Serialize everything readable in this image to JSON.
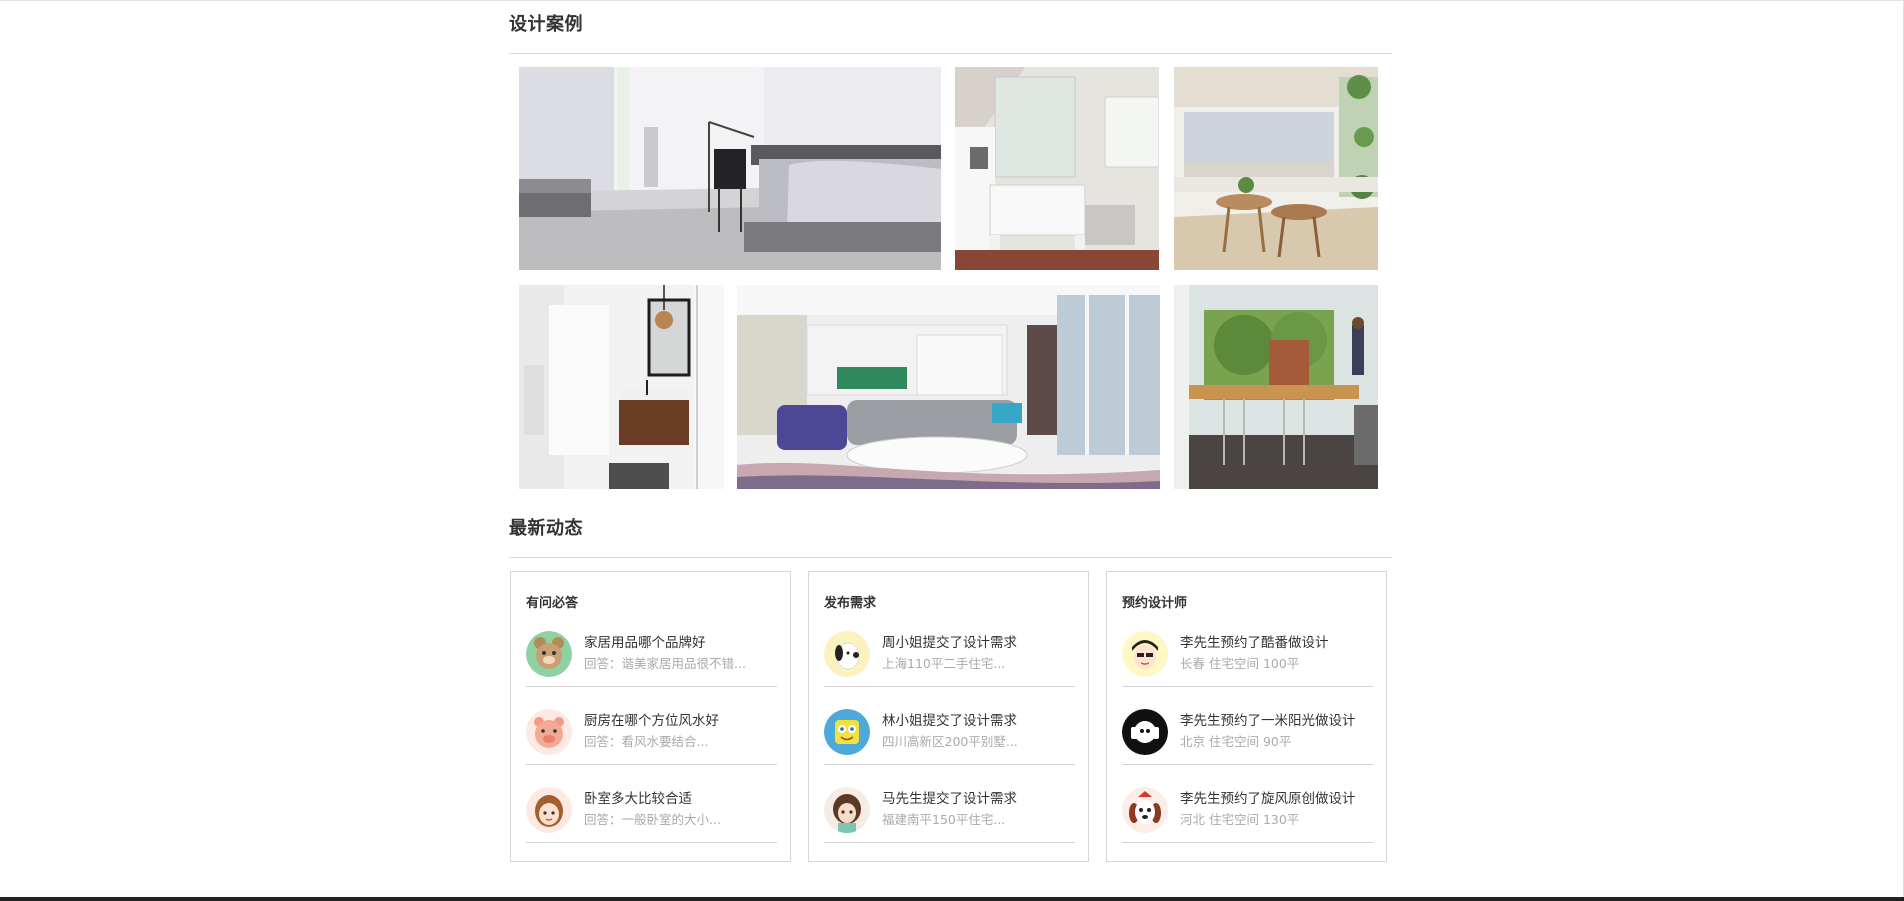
{
  "sections": {
    "cases_title": "设计案例",
    "news_title": "最新动态"
  },
  "cases": [
    {
      "name": "bedroom",
      "alt": "卧室"
    },
    {
      "name": "dressing-room",
      "alt": "梳妆间"
    },
    {
      "name": "sunroom",
      "alt": "阳光房"
    },
    {
      "name": "bathroom",
      "alt": "卫生间"
    },
    {
      "name": "living-room",
      "alt": "客厅"
    },
    {
      "name": "kitchen-bar",
      "alt": "厨房"
    }
  ],
  "panels": [
    {
      "title": "有问必答",
      "items": [
        {
          "title": "家居用品哪个品牌好",
          "sub": "回答：谐美家居用品很不错...",
          "avatar": "bear-icon"
        },
        {
          "title": "厨房在哪个方位风水好",
          "sub": "回答：看风水要结合...",
          "avatar": "pig-icon"
        },
        {
          "title": "卧室多大比较合适",
          "sub": "回答：一般卧室的大小...",
          "avatar": "girl-icon"
        }
      ]
    },
    {
      "title": "发布需求",
      "items": [
        {
          "title": "周小姐提交了设计需求",
          "sub": "上海110平二手住宅...",
          "avatar": "snoopy-icon"
        },
        {
          "title": "林小姐提交了设计需求",
          "sub": "四川高新区200平别墅...",
          "avatar": "sponge-icon"
        },
        {
          "title": "马先生提交了设计需求",
          "sub": "福建南平150平住宅...",
          "avatar": "girl-brown-icon"
        }
      ]
    },
    {
      "title": "预约设计师",
      "items": [
        {
          "title": "李先生预约了酷番做设计",
          "sub": "长春 住宅空间 100平",
          "avatar": "boy-icon"
        },
        {
          "title": "李先生预约了一米阳光做设计",
          "sub": "北京 住宅空间 90平",
          "avatar": "music-icon"
        },
        {
          "title": "李先生预约了旋风原创做设计",
          "sub": "河北 住宅空间 130平",
          "avatar": "dog-icon"
        }
      ]
    }
  ],
  "colors": {
    "text": "#333333",
    "muted": "#aaaaaa",
    "rule": "#d9d9d9"
  }
}
